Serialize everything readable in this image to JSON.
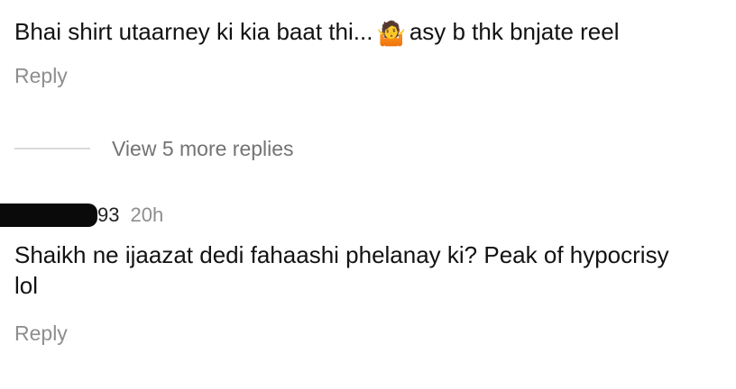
{
  "comments": [
    {
      "text_before": "Bhai shirt utaarney ki kia baat thi...",
      "emoji_icon": "person-shrugging-icon",
      "text_after": "asy b thk bnjate reel",
      "reply_label": "Reply"
    },
    {
      "username_visible": "93",
      "timestamp": "20h",
      "text": "Shaikh ne ijaazat dedi fahaashi phelanay ki?  Peak of hypocrisy lol",
      "reply_label": "Reply"
    }
  ],
  "view_replies_label": "View 5 more replies"
}
